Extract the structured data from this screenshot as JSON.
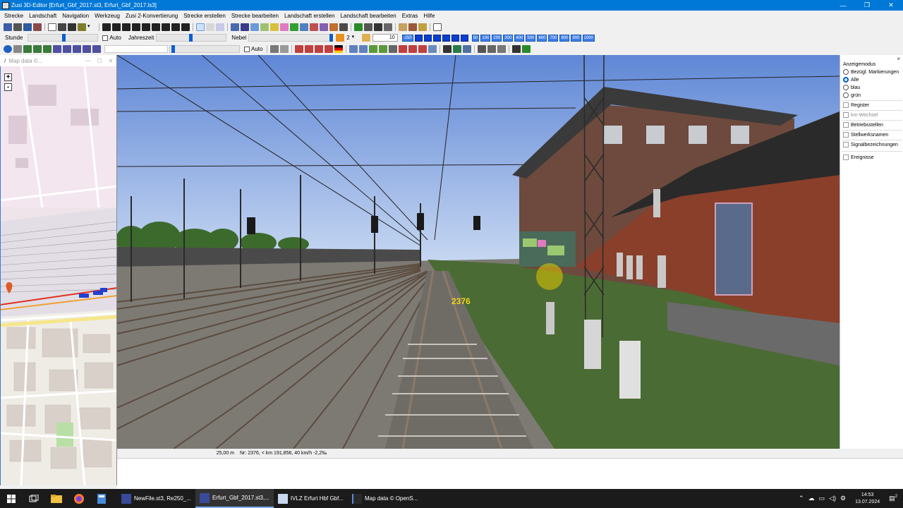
{
  "window": {
    "title": "Zusi 3D-Editor [Erfurt_Gbf_2017.st3, Erfurt_Gbf_2017.ls3]",
    "minimize": "—",
    "maximize": "❐",
    "close": "✕"
  },
  "menu": [
    "Strecke",
    "Landschaft",
    "Navigation",
    "Werkzeug",
    "Zusi 2-Konvertierung",
    "Strecke erstellen",
    "Strecke bearbeiten",
    "Landschaft erstellen",
    "Landschaft bearbeiten",
    "Extras",
    "Hilfe"
  ],
  "toolbar2": {
    "stunde": "Stunde",
    "auto1": "Auto",
    "jahreszeit": "Jahreszeit",
    "nebel": "Nebel",
    "level": "2",
    "spin_value": "10",
    "num_buttons": [
      "-250",
      "50",
      "100",
      "200",
      "300",
      "400",
      "500",
      "600",
      "700",
      "800",
      "900",
      "1000"
    ]
  },
  "toolbar3": {
    "auto2": "Auto"
  },
  "map": {
    "title": "Map data ©...",
    "zoom_in": "+",
    "zoom_out": "-"
  },
  "view": {
    "km_label": "2376"
  },
  "right_panel": {
    "close": "×",
    "header": "Anzeigemodus",
    "radios": [
      {
        "label": "Bezügl. Markierungen",
        "selected": false
      },
      {
        "label": "Alle",
        "selected": true
      },
      {
        "label": "blau",
        "selected": false
      },
      {
        "label": "grün",
        "selected": false
      }
    ],
    "checks": [
      {
        "label": "Register",
        "disabled": false
      },
      {
        "label": "km-Wechsel",
        "disabled": true
      },
      {
        "label": "Betriebsstellen",
        "disabled": false
      },
      {
        "label": "Stellwerksnamen",
        "disabled": false
      },
      {
        "label": "Signalbezeichnungen",
        "disabled": false
      },
      {
        "label": "Ereignisse",
        "disabled": false
      }
    ]
  },
  "status": {
    "distance": "25,00 m",
    "info": "Nr: 2376, < km 191,856, 40 km/h  -2,2‰"
  },
  "taskbar": {
    "apps": [
      {
        "label": "NewFile.st3, Re250_...",
        "active": false
      },
      {
        "label": "Erfurt_Gbf_2017.st3,...",
        "active": true
      },
      {
        "label": "IVLZ Erfurt Hbf Gbf...",
        "active": false
      },
      {
        "label": "Map data © OpenS...",
        "active": false
      }
    ],
    "time": "14:53",
    "date": "13.07.2024",
    "notifications": "2"
  },
  "colors": {
    "titlebar": "#0078d7",
    "accent": "#0a3fd0",
    "km_label": "#f2d21a"
  }
}
